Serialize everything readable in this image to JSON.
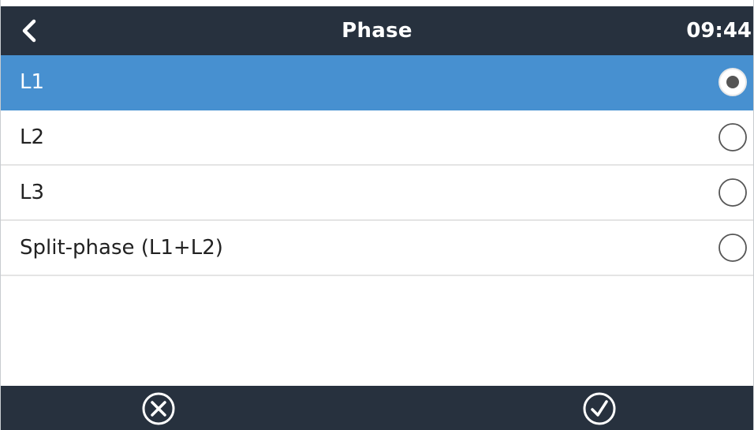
{
  "header": {
    "title": "Phase",
    "time": "09:44",
    "back_icon": "chevron-left-icon"
  },
  "options": [
    {
      "label": "L1",
      "selected": true
    },
    {
      "label": "L2",
      "selected": false
    },
    {
      "label": "L3",
      "selected": false
    },
    {
      "label": "Split-phase (L1+L2)",
      "selected": false
    }
  ],
  "footer": {
    "cancel_icon": "circle-x-icon",
    "confirm_icon": "circle-check-icon"
  },
  "colors": {
    "header_bg": "#27313e",
    "selected_bg": "#4790d0",
    "divider": "#e4e4e4"
  }
}
